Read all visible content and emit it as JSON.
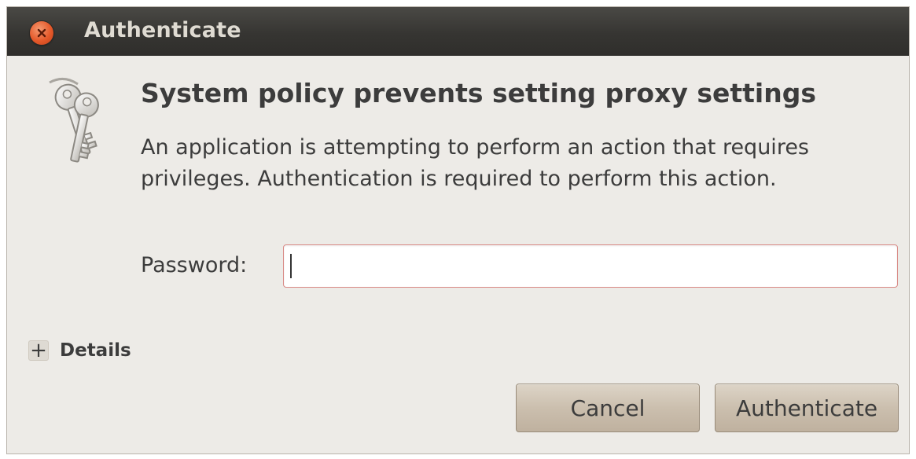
{
  "window": {
    "title": "Authenticate"
  },
  "dialog": {
    "icon": "keys-icon",
    "heading": "System policy prevents setting proxy settings",
    "message": "An application is attempting to perform an action that requires privileges. Authentication is required to perform this action.",
    "password_label": "Password:",
    "password_value": "",
    "details_symbol": "+",
    "details_label": "Details"
  },
  "buttons": {
    "cancel_label": "Cancel",
    "authenticate_label": "Authenticate"
  },
  "colors": {
    "titlebar": "#363532",
    "close_button": "#e5592a",
    "dialog_bg": "#edebe7",
    "input_border": "#d98a86",
    "button_bg": "#cbbfae"
  }
}
